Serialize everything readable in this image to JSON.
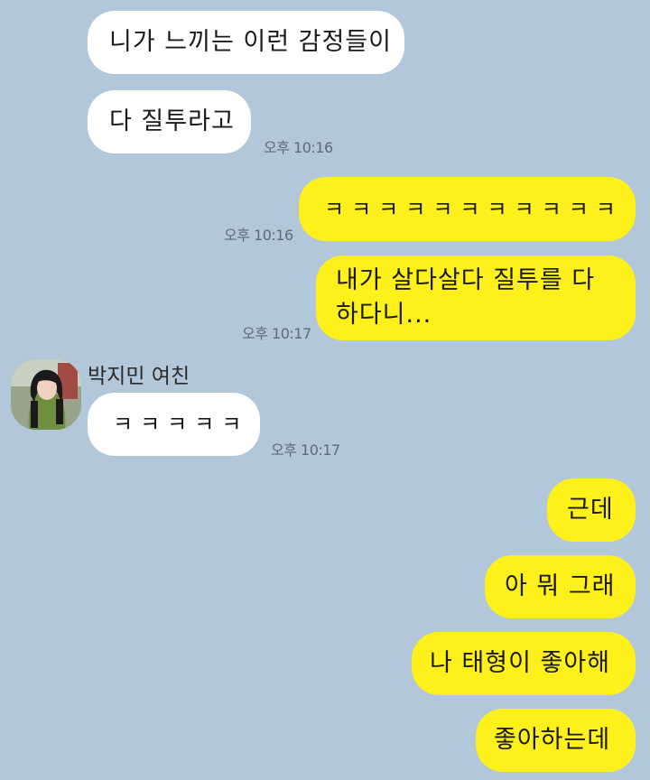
{
  "messages": [
    {
      "text": "니가 느끼는 이런 감정들이"
    },
    {
      "text": "다 질투라고",
      "time": "오후 10:16"
    },
    {
      "text": "ㅋㅋㅋㅋㅋㅋㅋㅋㅋㅋㅋ",
      "time": "오후 10:16"
    },
    {
      "text_line1": "내가 살다살다 질투를 다",
      "text_line2": "하다니...",
      "time": "오후 10:17"
    },
    {
      "sender": "박지민 여친",
      "text": "ㅋㅋㅋㅋㅋ",
      "time": "오후 10:17"
    },
    {
      "text": "근데"
    },
    {
      "text": "아 뭐 그래"
    },
    {
      "text": "나 태형이 좋아해"
    },
    {
      "text": "좋아하는데"
    }
  ],
  "colors": {
    "background": "#b2c7d9",
    "incoming_bubble": "#ffffff",
    "outgoing_bubble": "#fef01b",
    "timestamp": "#5b6b78"
  },
  "icons": {
    "avatar": "profile-photo"
  }
}
